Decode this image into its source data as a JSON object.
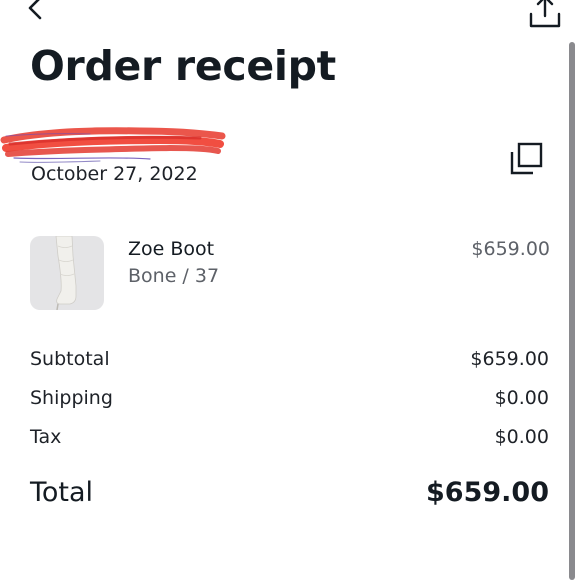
{
  "header": {
    "title": "Order receipt"
  },
  "order": {
    "date": "October 27, 2022"
  },
  "item": {
    "name": "Zoe Boot",
    "variant": "Bone / 37",
    "price": "$659.00"
  },
  "summary": {
    "subtotal_label": "Subtotal",
    "subtotal_value": "$659.00",
    "shipping_label": "Shipping",
    "shipping_value": "$0.00",
    "tax_label": "Tax",
    "tax_value": "$0.00",
    "total_label": "Total",
    "total_value": "$659.00"
  },
  "icons": {
    "back": "chevron-left-icon",
    "share": "share-icon",
    "copy": "copy-icon"
  },
  "colors": {
    "text_primary": "#141b22",
    "text_secondary": "#5d6168",
    "redaction": "#ef3b2c",
    "thumbnail_bg": "#e4e4e6"
  }
}
